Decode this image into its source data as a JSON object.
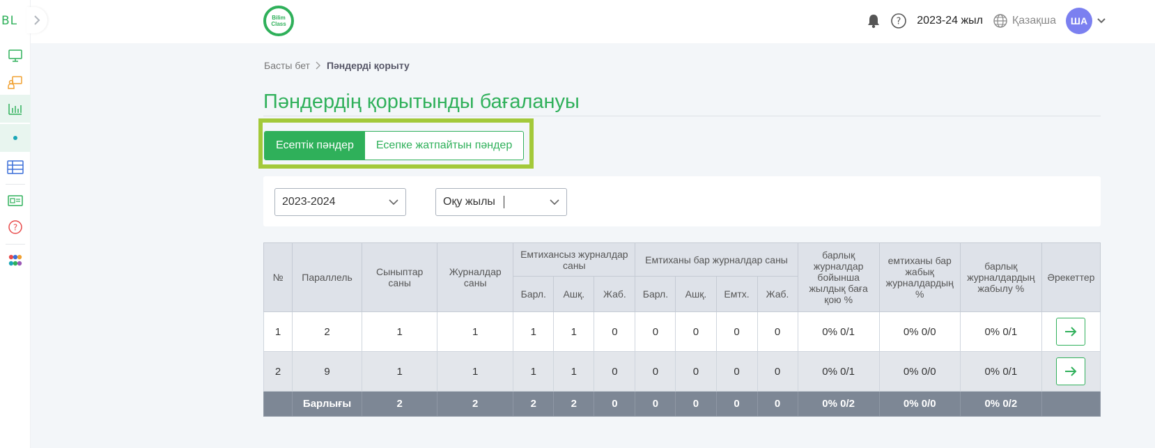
{
  "sidebar": {
    "logo": "BL",
    "items": [
      {
        "icon": "monitor-icon"
      },
      {
        "icon": "presentation-icon"
      },
      {
        "icon": "bar-chart-icon"
      },
      {
        "icon": "dot-icon"
      },
      {
        "icon": "table-icon"
      },
      {
        "icon": "id-card-icon"
      },
      {
        "icon": "help-circle-icon"
      },
      {
        "icon": "apps-icon"
      }
    ]
  },
  "header": {
    "brand_line1": "Bilim",
    "brand_line2": "Class",
    "academic_year": "2023-24 жыл",
    "language": "Қазақша",
    "avatar_initials": "ША"
  },
  "breadcrumb": {
    "home": "Басты бет",
    "current": "Пәндерді қорыту"
  },
  "page": {
    "title": "Пәндердің қорытынды бағалануы"
  },
  "tabs": [
    {
      "label": "Есептік пәндер",
      "active": true
    },
    {
      "label": "Есепке жатпайтын пәндер",
      "active": false
    }
  ],
  "filters": {
    "year_value": "2023-2024",
    "period_value": "Оқу жылы"
  },
  "table": {
    "headers": {
      "no": "№",
      "parallel": "Параллель",
      "classes": "Сыныптар саны",
      "journals": "Журналдар саны",
      "no_exam_group": "Емтихансыз журналдар саны",
      "exam_group": "Емтиханы бар журналдар саны",
      "grading_pct": "барлық журналдар бойынша жылдық баға қою %",
      "exam_closed_pct": "емтиханы бар жабық журналдардың %",
      "closed_pct": "барлық журналдардың жабылу %",
      "actions": "Әрекеттер",
      "sub_all": "Барл.",
      "sub_open": "Ашқ.",
      "sub_closed": "Жаб.",
      "sub_exam": "Емтх."
    },
    "rows": [
      {
        "no": "1",
        "parallel": "2",
        "classes": "1",
        "journals": "1",
        "ne_all": "1",
        "ne_open": "1",
        "ne_closed": "0",
        "e_all": "0",
        "e_open": "0",
        "e_exam": "0",
        "e_closed": "0",
        "grading": "0% 0/1",
        "exam_closed": "0% 0/0",
        "closed": "0% 0/1"
      },
      {
        "no": "2",
        "parallel": "9",
        "classes": "1",
        "journals": "1",
        "ne_all": "1",
        "ne_open": "1",
        "ne_closed": "0",
        "e_all": "0",
        "e_open": "0",
        "e_exam": "0",
        "e_closed": "0",
        "grading": "0% 0/1",
        "exam_closed": "0% 0/0",
        "closed": "0% 0/1"
      }
    ],
    "total": {
      "label": "Барлығы",
      "classes": "2",
      "journals": "2",
      "ne_all": "2",
      "ne_open": "2",
      "ne_closed": "0",
      "e_all": "0",
      "e_open": "0",
      "e_exam": "0",
      "e_closed": "0",
      "grading": "0% 0/2",
      "exam_closed": "0% 0/0",
      "closed": "0% 0/2"
    }
  },
  "colors": {
    "accent": "#2fb05a",
    "highlight_frame": "#a3c93a",
    "avatar": "#7b80f0",
    "total_row": "#7d8795"
  }
}
